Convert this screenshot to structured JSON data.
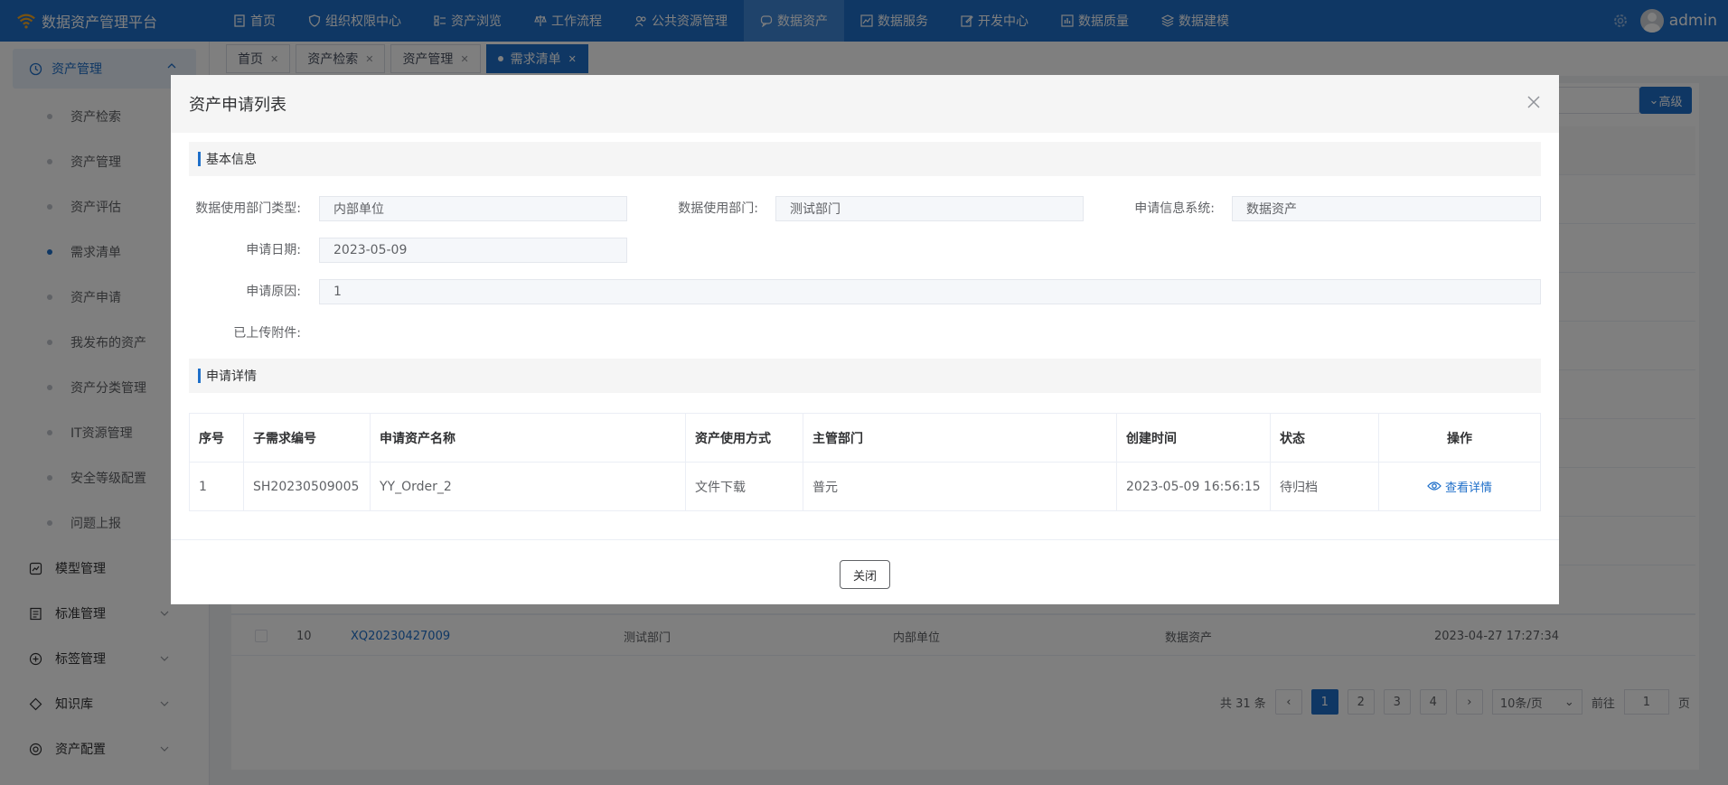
{
  "app": {
    "title": "数据资产管理平台",
    "username": "admin"
  },
  "nav": [
    {
      "label": "首页",
      "icon": "document-icon"
    },
    {
      "label": "组织权限中心",
      "icon": "shield-icon"
    },
    {
      "label": "资产浏览",
      "icon": "list-icon"
    },
    {
      "label": "工作流程",
      "icon": "scale-icon"
    },
    {
      "label": "公共资源管理",
      "icon": "people-icon"
    },
    {
      "label": "数据资产",
      "icon": "chat-icon",
      "active": true
    },
    {
      "label": "数据服务",
      "icon": "chart-icon"
    },
    {
      "label": "开发中心",
      "icon": "edit-icon"
    },
    {
      "label": "数据质量",
      "icon": "bar-chart-icon"
    },
    {
      "label": "数据建模",
      "icon": "layers-icon"
    }
  ],
  "sidebar": {
    "group": {
      "label": "资产管理"
    },
    "sub_items": [
      {
        "label": "资产检索"
      },
      {
        "label": "资产管理"
      },
      {
        "label": "资产评估"
      },
      {
        "label": "需求清单",
        "active": true
      },
      {
        "label": "资产申请"
      },
      {
        "label": "我发布的资产"
      },
      {
        "label": "资产分类管理"
      },
      {
        "label": "IT资源管理"
      },
      {
        "label": "安全等级配置"
      },
      {
        "label": "问题上报"
      }
    ],
    "root_items": [
      {
        "label": "模型管理"
      },
      {
        "label": "标准管理"
      },
      {
        "label": "标签管理"
      },
      {
        "label": "知识库"
      },
      {
        "label": "资产配置"
      }
    ]
  },
  "tabs": [
    {
      "label": "首页"
    },
    {
      "label": "资产检索"
    },
    {
      "label": "资产管理"
    },
    {
      "label": "需求清单",
      "active": true
    }
  ],
  "background": {
    "advanced_label": "高级",
    "row10": {
      "index": "10",
      "code": "XQ20230427009",
      "dept": "测试部门",
      "dept_type": "内部单位",
      "system": "数据资产",
      "time": "2023-04-27 17:27:34"
    },
    "pager": {
      "total": "共 31 条",
      "pages": [
        "1",
        "2",
        "3",
        "4"
      ],
      "page_size": "10条/页",
      "goto_prefix": "前往",
      "goto_value": "1",
      "goto_suffix": "页"
    }
  },
  "dialog": {
    "title": "资产申请列表",
    "section_basic": "基本信息",
    "section_detail": "申请详情",
    "fields": {
      "dept_type_label": "数据使用部门类型:",
      "dept_type_value": "内部单位",
      "dept_label": "数据使用部门:",
      "dept_value": "测试部门",
      "system_label": "申请信息系统:",
      "system_value": "数据资产",
      "date_label": "申请日期:",
      "date_value": "2023-05-09",
      "reason_label": "申请原因:",
      "reason_value": "1",
      "attachment_label": "已上传附件:"
    },
    "table": {
      "headers": [
        "序号",
        "子需求编号",
        "申请资产名称",
        "资产使用方式",
        "主管部门",
        "创建时间",
        "状态",
        "操作"
      ],
      "rows": [
        {
          "index": "1",
          "code": "SH20230509005",
          "asset": "YY_Order_2",
          "usage": "文件下载",
          "owner_dept": "普元",
          "created": "2023-05-09 16:56:15",
          "status": "待归档",
          "action": "查看详情"
        }
      ]
    },
    "close_label": "关闭"
  },
  "colors": {
    "primary": "#1f6fc9",
    "overlay": "rgba(0,0,0,0.5)"
  }
}
